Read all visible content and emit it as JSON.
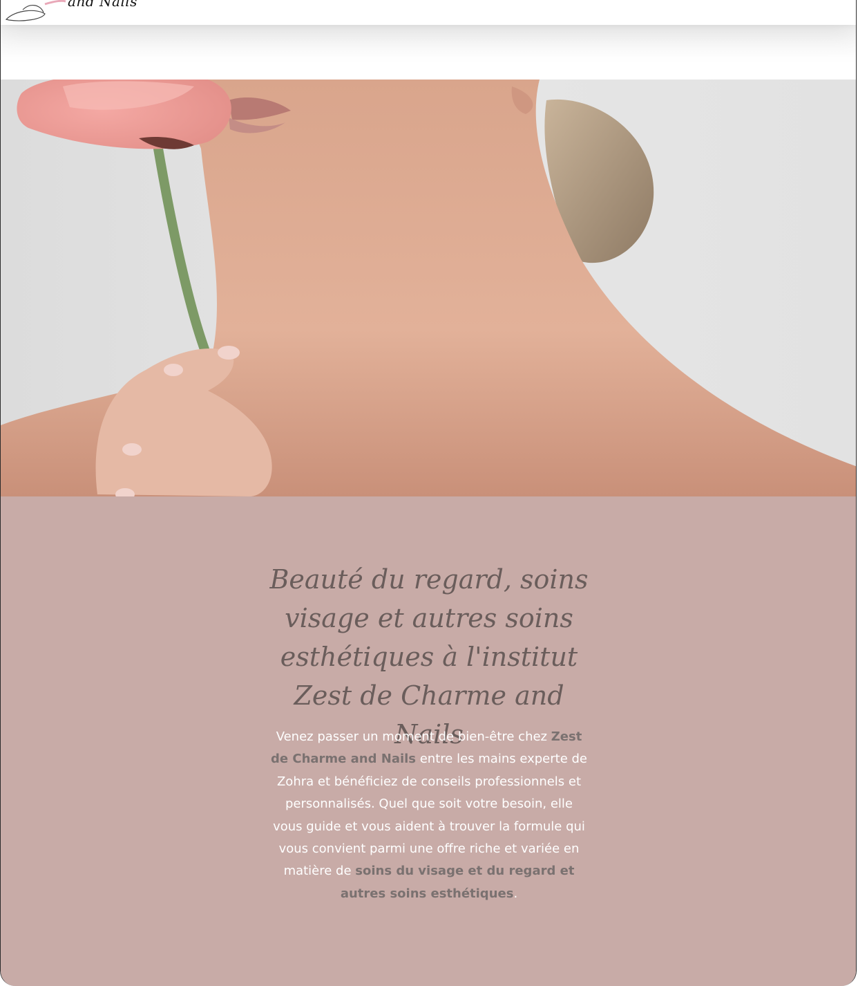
{
  "header": {
    "logo_text": "and Nails"
  },
  "hero": {
    "image_description": "woman-with-pink-flower"
  },
  "main": {
    "title": "Beauté du regard, soins visage et autres soins esthétiques à l'institut Zest de Charme and Nails",
    "paragraph": {
      "part1": "Venez passer un moment de bien-être chez ",
      "brand": "Zest de Charme and Nails",
      "part2": " entre les mains experte de Zohra et bénéficiez de conseils professionnels et personnalisés. Quel que soit votre besoin, elle vous guide et vous aident à trouver la formule qui vous convient parmi une offre riche et variée en matière de ",
      "services": "soins du visage et du regard et autres soins esthétiques",
      "end": "."
    }
  },
  "colors": {
    "content_bg": "#c8aba7",
    "title": "#6a5d5b",
    "highlight": "#7a7170"
  }
}
